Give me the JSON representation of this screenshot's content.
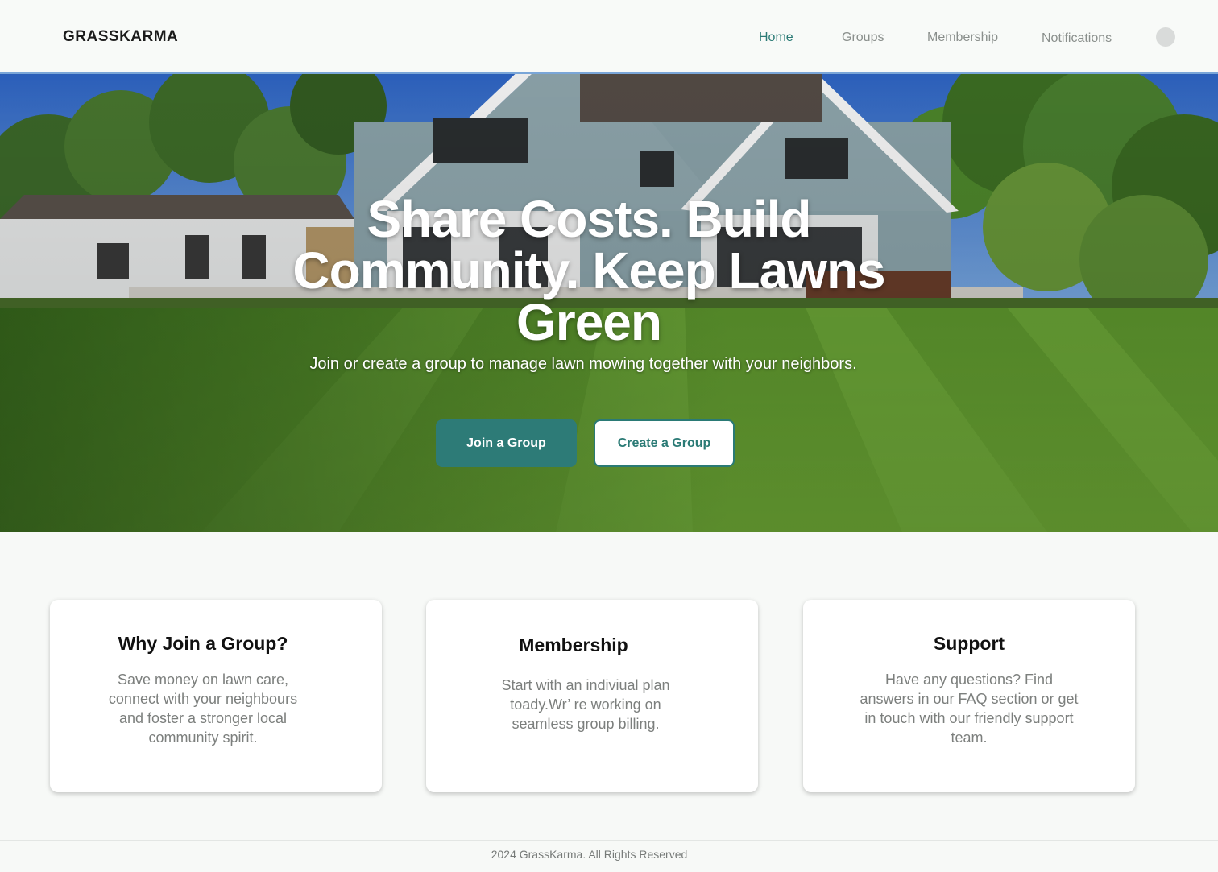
{
  "brand": "GRASSKARMA",
  "nav": {
    "home": "Home",
    "groups": "Groups",
    "membership": "Membership",
    "notifications": "Notifications"
  },
  "hero": {
    "title_line1": "Share Costs. Build",
    "title_line2": "Community. Keep Lawns",
    "title_line3": "Green",
    "subtitle": "Join or create a group to manage lawn mowing together with your neighbors.",
    "join_button": "Join a Group",
    "create_button": "Create a Group"
  },
  "cards": [
    {
      "title": "Why Join a Group?",
      "text": "Save money on lawn care, connect with your neighbours and foster a stronger local community spirit."
    },
    {
      "title": "Membership",
      "text": "Start with an indiviual plan toady.Wr’ re working on seamless group billing."
    },
    {
      "title": "Support",
      "text": "Have any questions? Find answers in our FAQ section or get in touch with our friendly support team."
    }
  ],
  "footer": "2024 GrassKarma.  All Rights Reserved",
  "colors": {
    "accent": "#2d7b77",
    "background": "#f7f9f7",
    "nav_inactive": "#8a8f8c"
  }
}
